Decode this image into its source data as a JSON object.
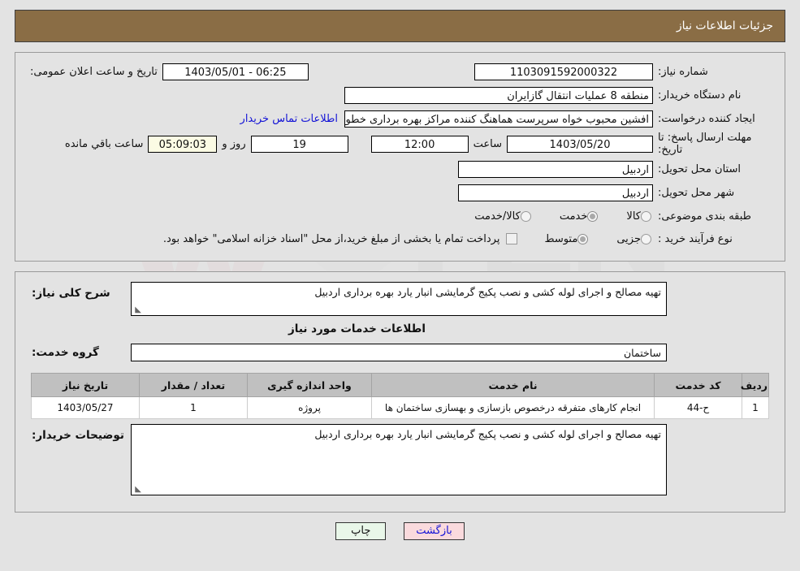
{
  "header": {
    "title": "جزئیات اطلاعات نیاز",
    "bar_color": "#8a6d45"
  },
  "info": {
    "need_number_label": "شماره نیاز:",
    "need_number_value": "1103091592000322",
    "announce_label": "تاریخ و ساعت اعلان عمومی:",
    "announce_value": "06:25 - 1403/05/01",
    "buyer_org_label": "نام دستگاه خریدار:",
    "buyer_org_value": "منطقه 8 عملیات انتقال گازایران",
    "creator_label": "ایجاد کننده درخواست:",
    "creator_value": "افشین محبوب خواه سرپرست هماهنگ کننده مراکز بهره برداری خطوط لوله منطق",
    "contact_link": "اطلاعات تماس خریدار",
    "deadline_label": "مهلت ارسال پاسخ: تا تاریخ:",
    "deadline_date": "1403/05/20",
    "time_label": "ساعت",
    "deadline_time": "12:00",
    "days_value": "19",
    "days_label": "روز و",
    "clock_value": "05:09:03",
    "remaining_label": "ساعت باقي مانده",
    "province_label": "استان محل تحویل:",
    "province_value": "اردبیل",
    "city_label": "شهر محل تحویل:",
    "city_value": "اردبیل",
    "category_label": "طبقه بندی موضوعی:",
    "category_options": [
      {
        "label": "کالا",
        "selected": false
      },
      {
        "label": "خدمت",
        "selected": true
      },
      {
        "label": "کالا/خدمت",
        "selected": false
      }
    ],
    "process_label": "نوع فرآیند خرید :",
    "process_options": [
      {
        "label": "جزیی",
        "selected": false
      },
      {
        "label": "متوسط",
        "selected": true
      }
    ],
    "treasury_checked": false,
    "treasury_note": "پرداخت تمام یا بخشی از مبلغ خرید،از محل \"اسناد خزانه اسلامی\" خواهد بود."
  },
  "details": {
    "summary_label": "شرح کلی نیاز:",
    "summary_value": "تهیه مصالح و اجرای لوله کشی و نصب پکیج گرمایشی انبار یارد بهره برداری اردبیل",
    "services_heading": "اطلاعات خدمات مورد نیاز",
    "service_group_label": "گروه خدمت:",
    "service_group_value": "ساختمان",
    "buyer_notes_label": "توضیحات خریدار:",
    "buyer_notes_value": "تهیه مصالح و اجرای لوله کشی و نصب پکیج گرمایشی انبار یارد بهره برداری اردبیل"
  },
  "table": {
    "columns": [
      "ردیف",
      "کد خدمت",
      "نام خدمت",
      "واحد اندازه گیری",
      "تعداد / مقدار",
      "تاریخ نیاز"
    ],
    "rows": [
      {
        "radif": "1",
        "code": "ح-44",
        "name": "انجام کارهای متفرقه درخصوص بازسازی و بهسازی ساختمان ها",
        "unit": "پروژه",
        "qty": "1",
        "date": "1403/05/27"
      }
    ]
  },
  "buttons": {
    "print": "چاپ",
    "back": "بازگشت"
  },
  "watermark": {
    "text": "AriaTender.net"
  }
}
